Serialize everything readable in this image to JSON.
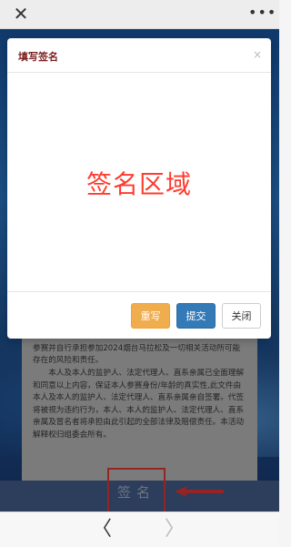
{
  "browser": {
    "close_glyph": "✕",
    "more_glyph": "•••",
    "back_glyph": "〈",
    "forward_glyph": "〉"
  },
  "document": {
    "lines": [
      "岁以下未成年人参赛需要其监护人或法定代理人在签署页签字，70周岁(含)以上参赛选手需要其直系亲属在签署页签字，以示参赛人的监护人、管理人、法定代理人、直系亲属认可其参赛并自行承担参加2024烟台马拉松及一切相关活动所可能存在的风险和责任。",
      "本人及本人的监护人、法定代理人、直系亲属已全面理解和同意以上内容，保证本人参赛身份/年龄的真实性,此文件由本人及本人的监护人、法定代理人、直系亲属亲自签署。代签将被视为违约行为，本人、本人的监护人、法定代理人、直系亲属及冒名者将承担由此引起的全部法律及赔偿责任。本活动解释权归组委会所有。"
    ]
  },
  "sign_button_label": "签名",
  "modal": {
    "title": "填写签名",
    "close_glyph": "×",
    "sign_area_text": "签名区域",
    "buttons": {
      "rewrite": "重写",
      "submit": "提交",
      "close": "关闭"
    }
  },
  "colors": {
    "annotation": "#e53935",
    "rewrite_bg": "#f0ad4e",
    "submit_bg": "#337ab7",
    "sign_area_text": "#ff3b2f"
  }
}
